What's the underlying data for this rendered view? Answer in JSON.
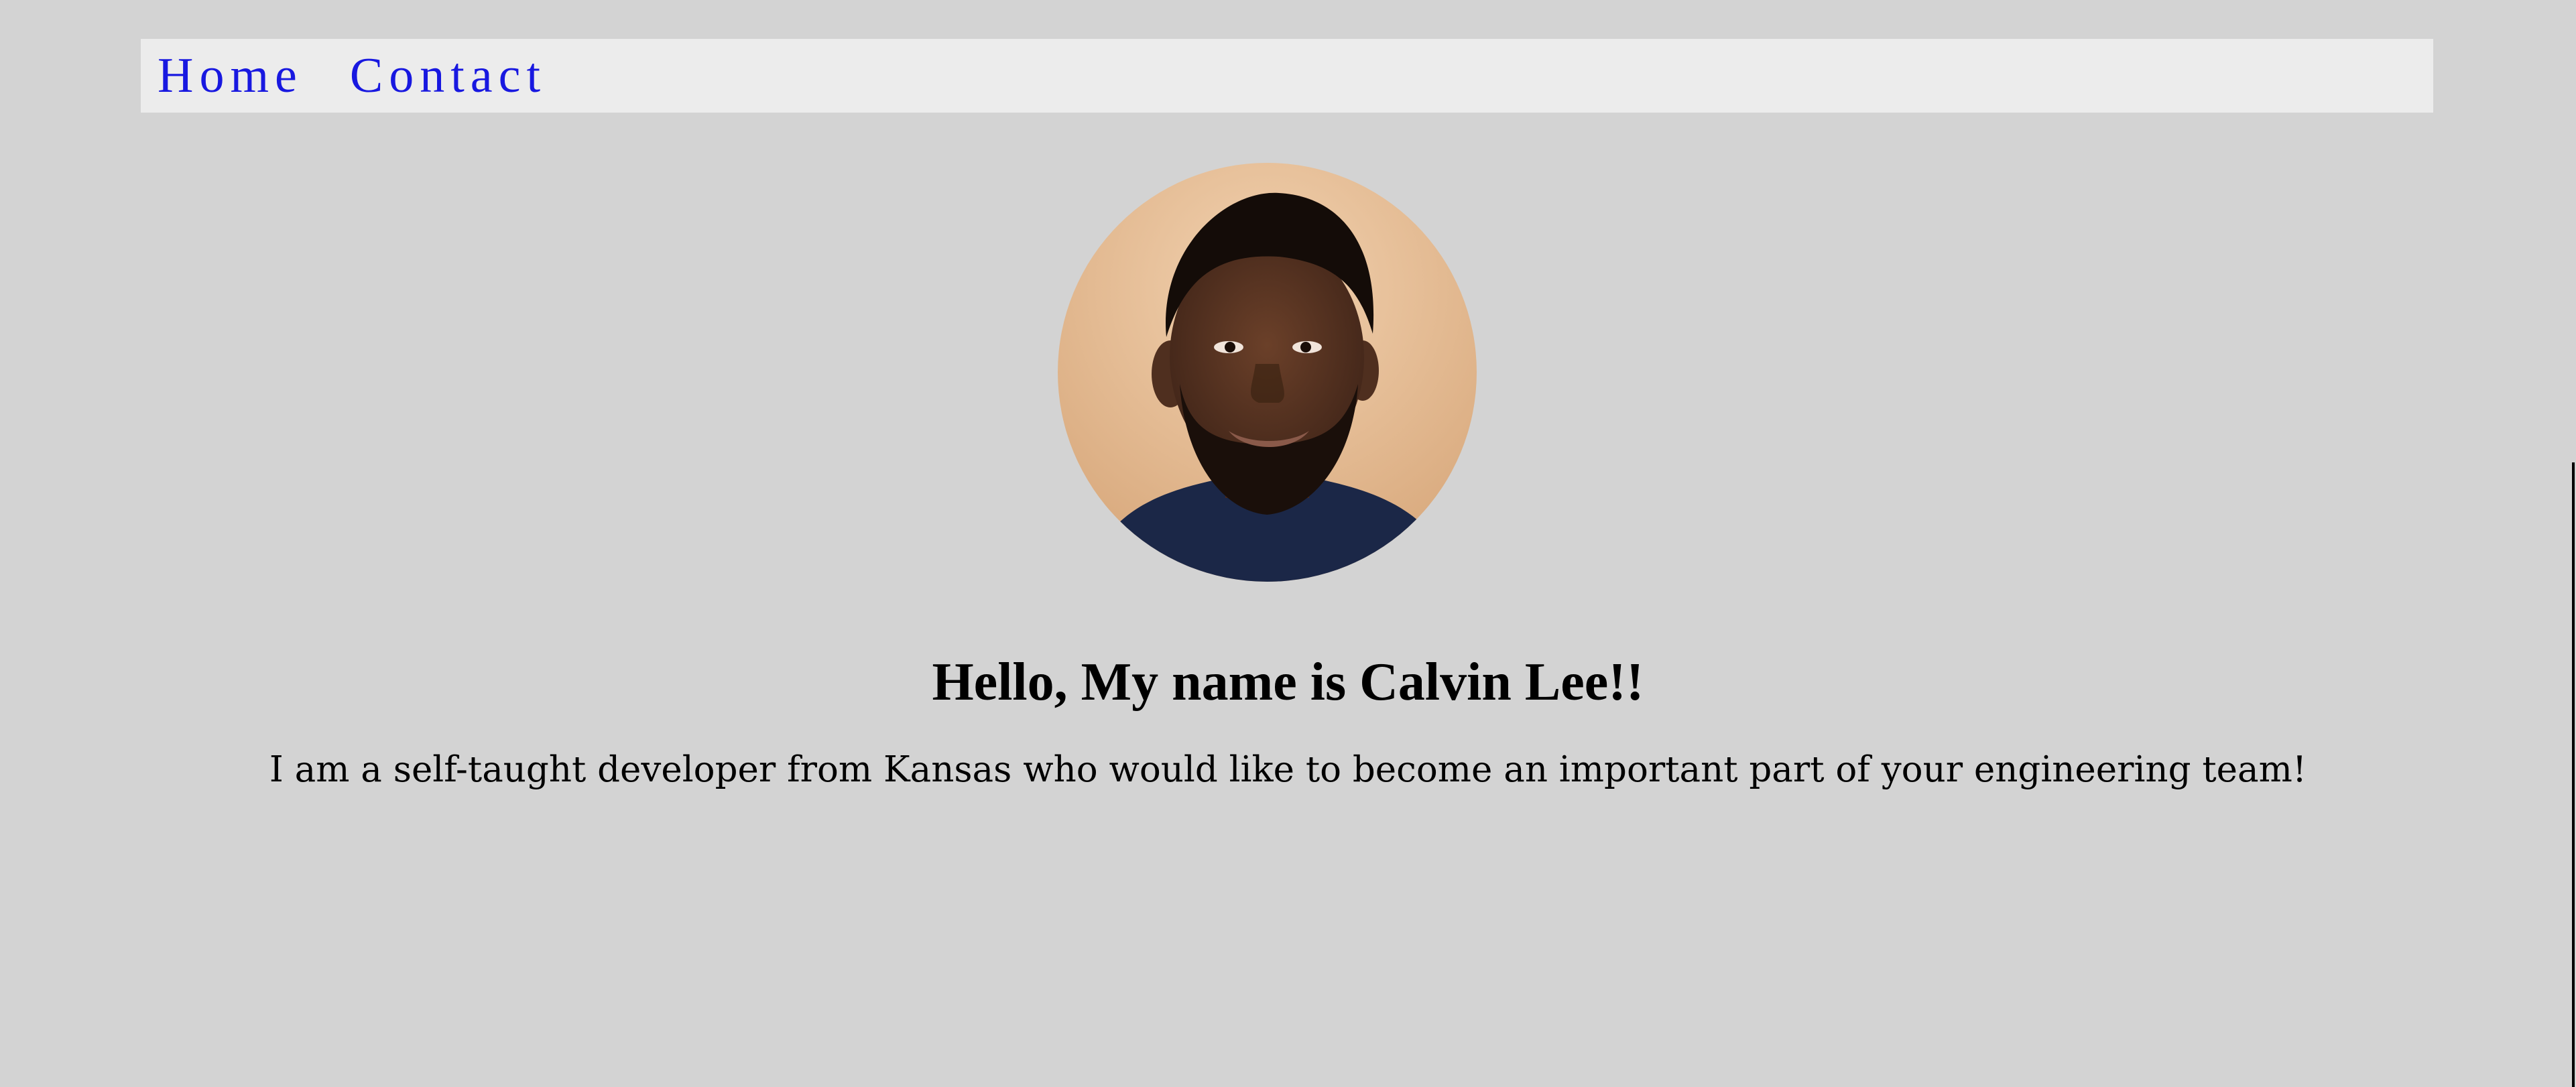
{
  "nav": {
    "items": [
      {
        "label": "Home"
      },
      {
        "label": "Contact"
      }
    ]
  },
  "hero": {
    "avatar_icon": "profile-photo",
    "title": "Hello, My name is Calvin Lee!!",
    "intro": "I am a self-taught developer from Kansas who would like to become an important part of your engineering team!"
  },
  "colors": {
    "background": "#d3d3d3",
    "nav_background": "#ececec",
    "link": "#1818e0",
    "text": "#000000",
    "avatar_backdrop": "#e6bf98",
    "shirt": "#1b2747"
  }
}
